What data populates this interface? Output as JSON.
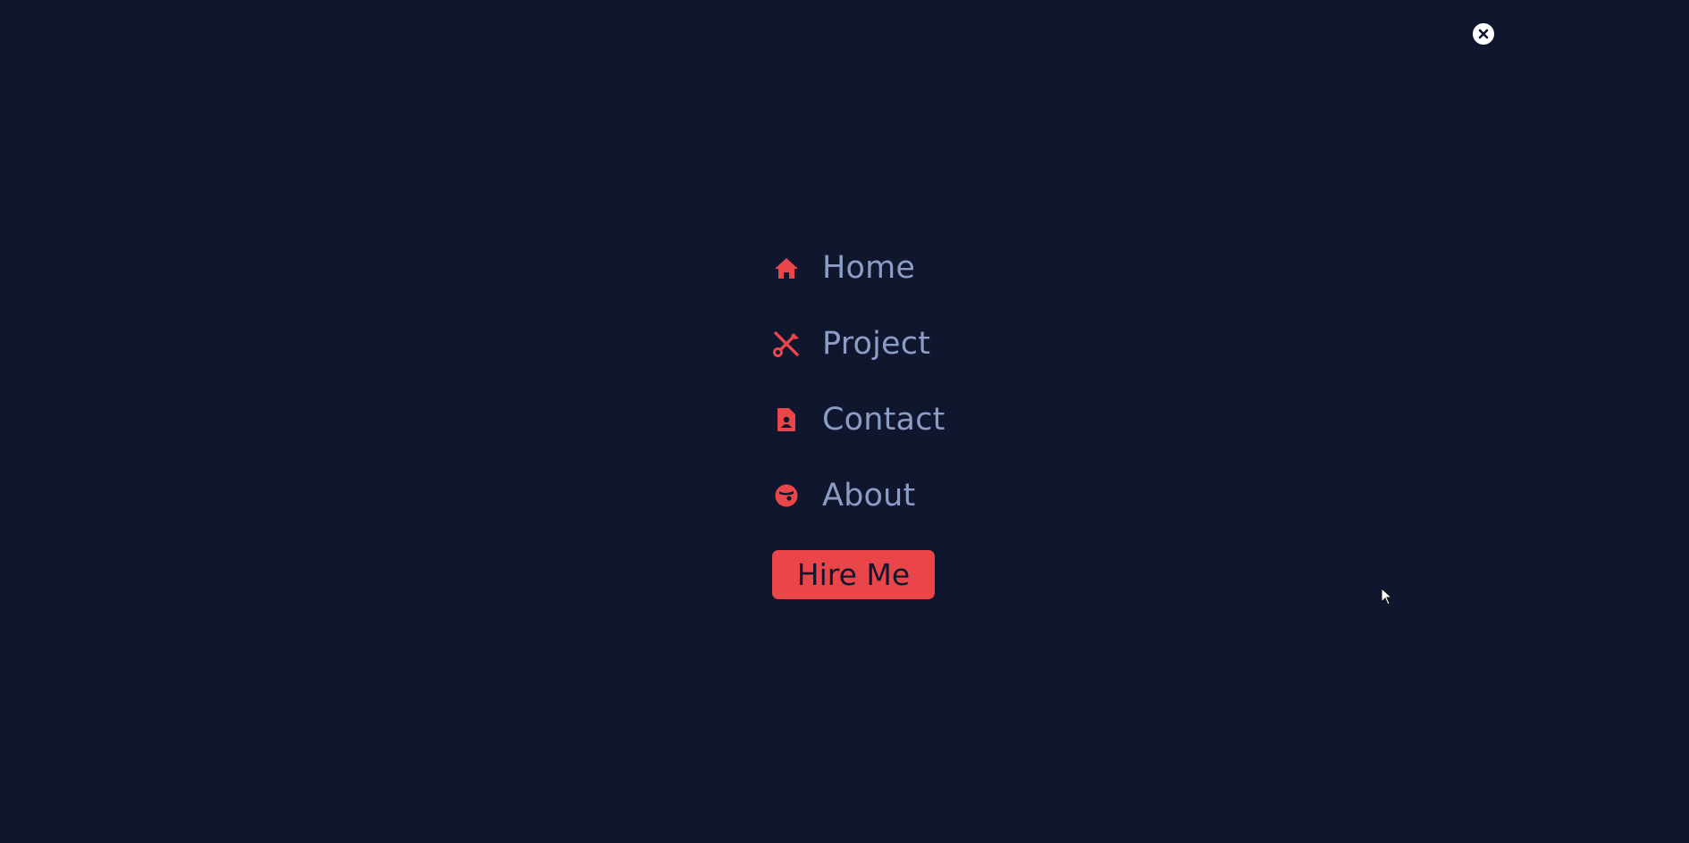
{
  "colors": {
    "background": "#0f162e",
    "accent": "#ea464a",
    "menu_text": "#8c9cc4",
    "close_button": "#ffffff"
  },
  "close_button": {
    "icon": "close-icon"
  },
  "menu": {
    "items": [
      {
        "label": "Home",
        "icon": "home-icon"
      },
      {
        "label": "Project",
        "icon": "tools-icon"
      },
      {
        "label": "Contact",
        "icon": "contact-card-icon"
      },
      {
        "label": "About",
        "icon": "face-icon"
      }
    ]
  },
  "cta": {
    "label": "Hire Me"
  },
  "cursor": {
    "icon": "mouse-pointer-icon"
  }
}
